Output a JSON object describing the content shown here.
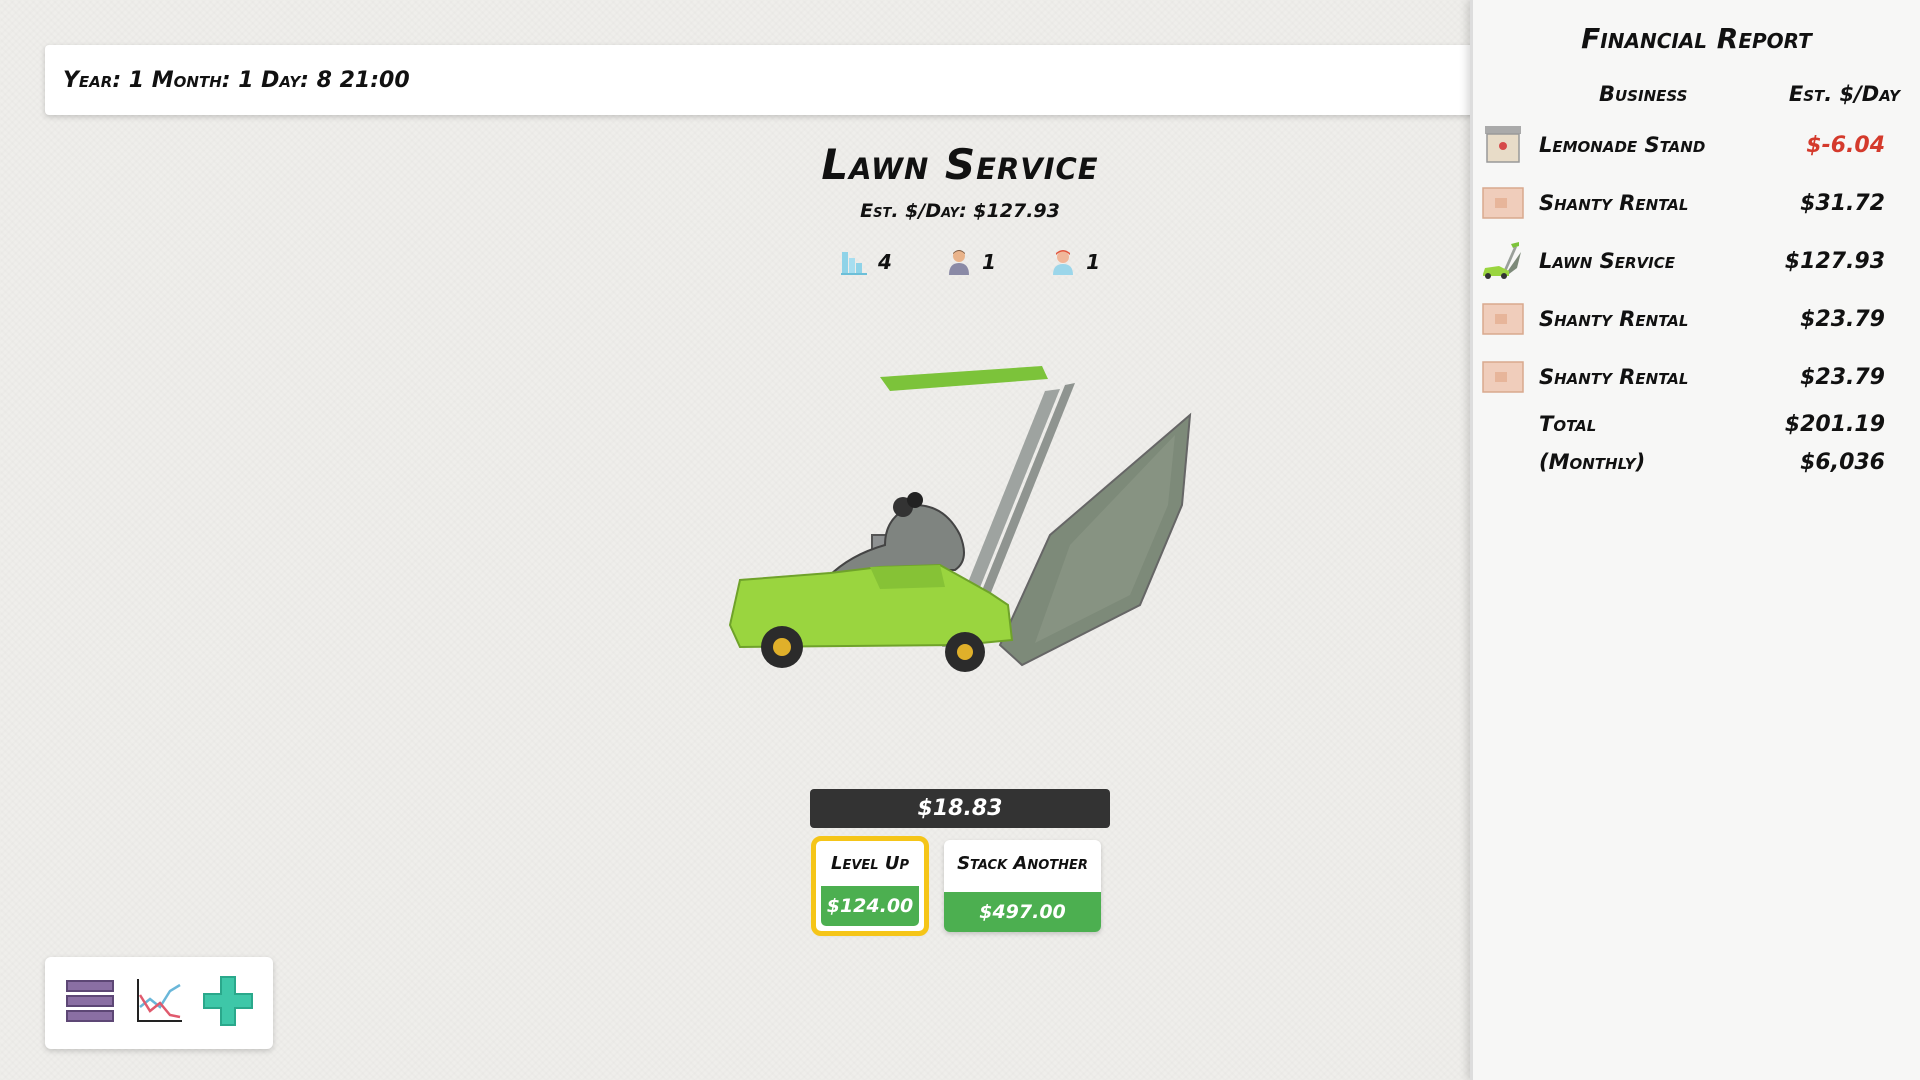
{
  "datebar": {
    "text": "Year: 1 Month: 1 Day: 8 21:00"
  },
  "business": {
    "title": "Lawn Service",
    "est_per_day": "Est. $/Day: $127.93",
    "stats": [
      {
        "icon": "building-icon",
        "value": "4"
      },
      {
        "icon": "worker-icon",
        "value": "1"
      },
      {
        "icon": "manager-icon",
        "value": "1"
      }
    ],
    "balance": "$18.83",
    "actions": [
      {
        "label": "Level Up",
        "price": "$124.00",
        "selected": true
      },
      {
        "label": "Stack Another",
        "price": "$497.00",
        "selected": false
      }
    ]
  },
  "toolbar": {
    "items": [
      {
        "icon": "menu-icon"
      },
      {
        "icon": "chart-icon"
      },
      {
        "icon": "plus-icon"
      }
    ]
  },
  "report": {
    "title": "Financial Report",
    "col_business": "Business",
    "col_est": "Est. $/Day",
    "rows": [
      {
        "name": "Lemonade Stand",
        "value": "$-6.04",
        "icon": "lemonade-stand-icon",
        "negative": true
      },
      {
        "name": "Shanty Rental",
        "value": "$31.72",
        "icon": "shanty-rental-icon",
        "negative": false
      },
      {
        "name": "Lawn Service",
        "value": "$127.93",
        "icon": "lawn-mower-icon",
        "negative": false
      },
      {
        "name": "Shanty Rental",
        "value": "$23.79",
        "icon": "shanty-rental-icon",
        "negative": false
      },
      {
        "name": "Shanty Rental",
        "value": "$23.79",
        "icon": "shanty-rental-icon",
        "negative": false
      }
    ],
    "total_label": "Total",
    "total_value": "$201.19",
    "monthly_label": "(Monthly)",
    "monthly_value": "$6,036"
  },
  "colors": {
    "action_green": "#4caf50",
    "selected_outline": "#f5c518",
    "negative_red": "#d43a2c",
    "balance_bar": "#333333"
  }
}
